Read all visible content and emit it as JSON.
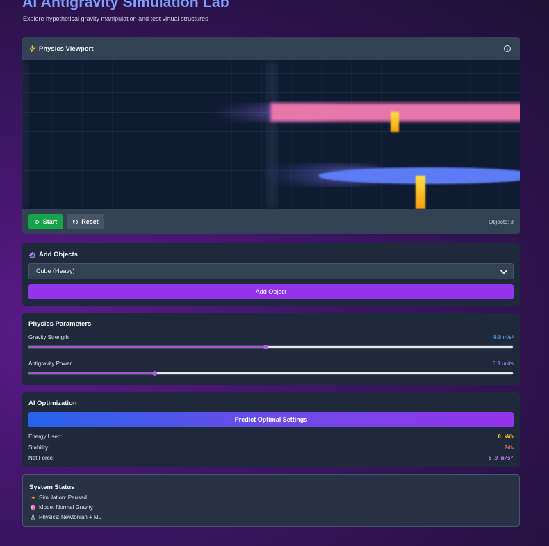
{
  "header": {
    "title": "AI Antigravity Simulation Lab",
    "subtitle": "Explore hypothetical gravity manipulation and test virtual structures"
  },
  "viewport": {
    "title": "Physics Viewport",
    "start_label": "Start",
    "reset_label": "Reset",
    "objects_count": "Objects: 3",
    "icons": [
      "bolt-icon",
      "info-icon",
      "play-icon",
      "reset-icon"
    ]
  },
  "add_objects": {
    "title": "Add Objects",
    "selected_object": "Cube (Heavy)",
    "add_button_label": "Add Object"
  },
  "physics": {
    "title": "Physics Parameters",
    "gravity": {
      "label": "Gravity Strength",
      "value": "9.8 m/s²",
      "level": 0.49,
      "color": "#60a5fa"
    },
    "antigravity": {
      "label": "Antigravity Power",
      "value": "3.9 units",
      "level": 0.26,
      "color": "#c084fc"
    }
  },
  "ai": {
    "title": "AI Optimization",
    "predict_label": "Predict Optimal Settings",
    "stats": [
      {
        "label": "Energy Used:",
        "value": "0 kWh",
        "color": "#facc15"
      },
      {
        "label": "Stability:",
        "value": "24%",
        "color": "#f87171"
      },
      {
        "label": "Net Force:",
        "value": "5.9 m/s²",
        "color": "#c084fc"
      }
    ]
  },
  "status": {
    "title": "System Status",
    "lines": [
      {
        "icon": "lightning-icon",
        "text": "Simulation: Paused"
      },
      {
        "icon": "wave-icon",
        "text": "Mode: Normal Gravity"
      },
      {
        "icon": "flask-icon",
        "text": "Physics: Newtonian + ML"
      }
    ]
  },
  "colors": {
    "accent_purple": "#9333ea",
    "start_green": "#16a34a",
    "title_blue": "#7ea0ff",
    "card_bg": "#1e293b"
  }
}
